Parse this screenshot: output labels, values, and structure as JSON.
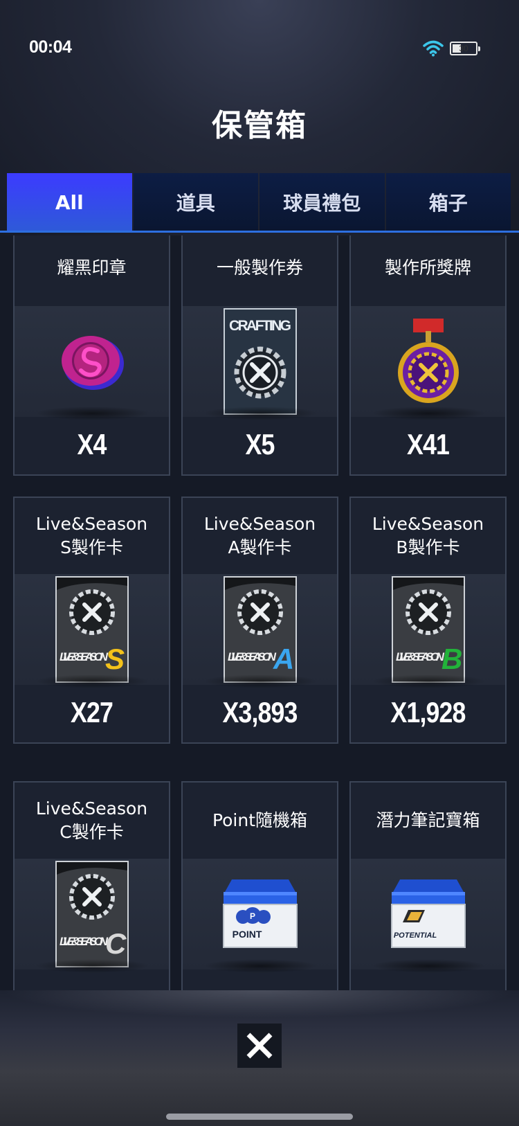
{
  "status": {
    "time": "00:04",
    "battery_level": "30"
  },
  "header": {
    "title": "保管箱"
  },
  "tabs": [
    {
      "label": "All",
      "active": true
    },
    {
      "label": "道具",
      "active": false
    },
    {
      "label": "球員禮包",
      "active": false
    },
    {
      "label": "箱子",
      "active": false
    }
  ],
  "items": [
    {
      "name": "耀黑印章",
      "count": "X4",
      "icon": "purple-seal-icon"
    },
    {
      "name": "一般製作券",
      "count": "X5",
      "icon": "crafting-ticket-icon",
      "art_text": "CRAFTING"
    },
    {
      "name": "製作所獎牌",
      "count": "X41",
      "icon": "gear-medal-icon"
    },
    {
      "name": "Live&Season\nS製作卡",
      "count": "X27",
      "icon": "live-season-card-icon",
      "grade": "S",
      "art_text": "LIVE & SEASON"
    },
    {
      "name": "Live&Season\nA製作卡",
      "count": "X3,893",
      "icon": "live-season-card-icon",
      "grade": "A",
      "art_text": "LIVE & SEASON"
    },
    {
      "name": "Live&Season\nB製作卡",
      "count": "X1,928",
      "icon": "live-season-card-icon",
      "grade": "B",
      "art_text": "LIVE & SEASON"
    },
    {
      "name": "Live&Season\nC製作卡",
      "count": "",
      "icon": "live-season-card-icon",
      "grade": "C",
      "art_text": "LIVE & SEASON"
    },
    {
      "name": "Point隨機箱",
      "count": "",
      "icon": "point-box-icon",
      "art_text": "POINT"
    },
    {
      "name": "潛力筆記寶箱",
      "count": "",
      "icon": "potential-box-icon",
      "art_text": "POTENTIAL"
    }
  ],
  "colors": {
    "tab_active": "#3c3bff",
    "tab_inactive": "#0d1d44",
    "grade_S": "#f4c21a",
    "grade_A": "#3aa6f0",
    "grade_B": "#22b33a",
    "grade_C": "#d8d8d8"
  },
  "close_icon": "close-icon"
}
